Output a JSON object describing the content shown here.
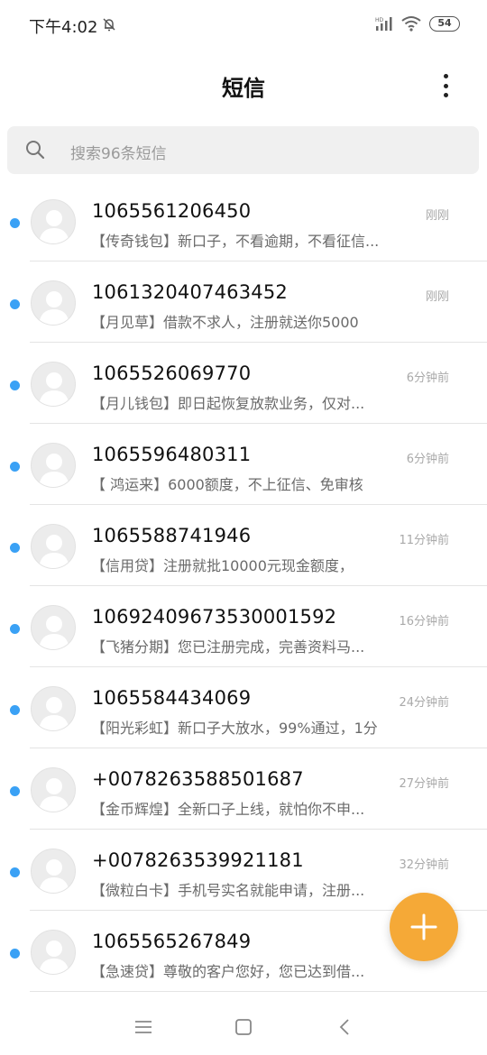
{
  "status_bar": {
    "time": "下午4:02",
    "battery": "54"
  },
  "header": {
    "title": "短信"
  },
  "search": {
    "placeholder": "搜索96条短信"
  },
  "colors": {
    "unread_dot": "#3aa1f5",
    "fab": "#f5a937"
  },
  "messages": [
    {
      "sender": "1065561206450",
      "snippet": "【传奇钱包】新口子，不看逾期，不看征信...",
      "time": "刚刚",
      "unread": true
    },
    {
      "sender": "1061320407463452",
      "snippet": "【月见草】借款不求人，注册就送你5000",
      "time": "刚刚",
      "unread": true
    },
    {
      "sender": "1065526069770",
      "snippet": "【月儿钱包】即日起恢复放款业务，仅对...",
      "time": "6分钟前",
      "unread": true
    },
    {
      "sender": "1065596480311",
      "snippet": "【 鸿运来】6000额度，不上征信、免审核",
      "time": "6分钟前",
      "unread": true
    },
    {
      "sender": "1065588741946",
      "snippet": "【信用贷】注册就批10000元现金额度，",
      "time": "11分钟前",
      "unread": true
    },
    {
      "sender": "10692409673530001592",
      "snippet": "【飞猪分期】您已注册完成，完善资料马...",
      "time": "16分钟前",
      "unread": true
    },
    {
      "sender": "1065584434069",
      "snippet": "【阳光彩虹】新口子大放水，99%通过，1分",
      "time": "24分钟前",
      "unread": true
    },
    {
      "sender": "+0078263588501687",
      "snippet": "【金币辉煌】全新口子上线，就怕你不申...",
      "time": "27分钟前",
      "unread": true
    },
    {
      "sender": "+0078263539921181",
      "snippet": "【微粒白卡】手机号实名就能申请，注册...",
      "time": "32分钟前",
      "unread": true
    },
    {
      "sender": "1065565267849",
      "snippet": "【急速贷】尊敬的客户您好，您已达到借...",
      "time": "",
      "unread": true
    }
  ],
  "icons": {
    "dnd": "bell-off-icon",
    "signal": "signal-hd-icon",
    "wifi": "wifi-icon",
    "more": "more-vertical-icon",
    "search": "search-icon",
    "avatar": "default-avatar-icon",
    "fab": "plus-icon",
    "nav_menu": "menu-icon",
    "nav_home": "home-square-icon",
    "nav_back": "back-chevron-icon"
  }
}
